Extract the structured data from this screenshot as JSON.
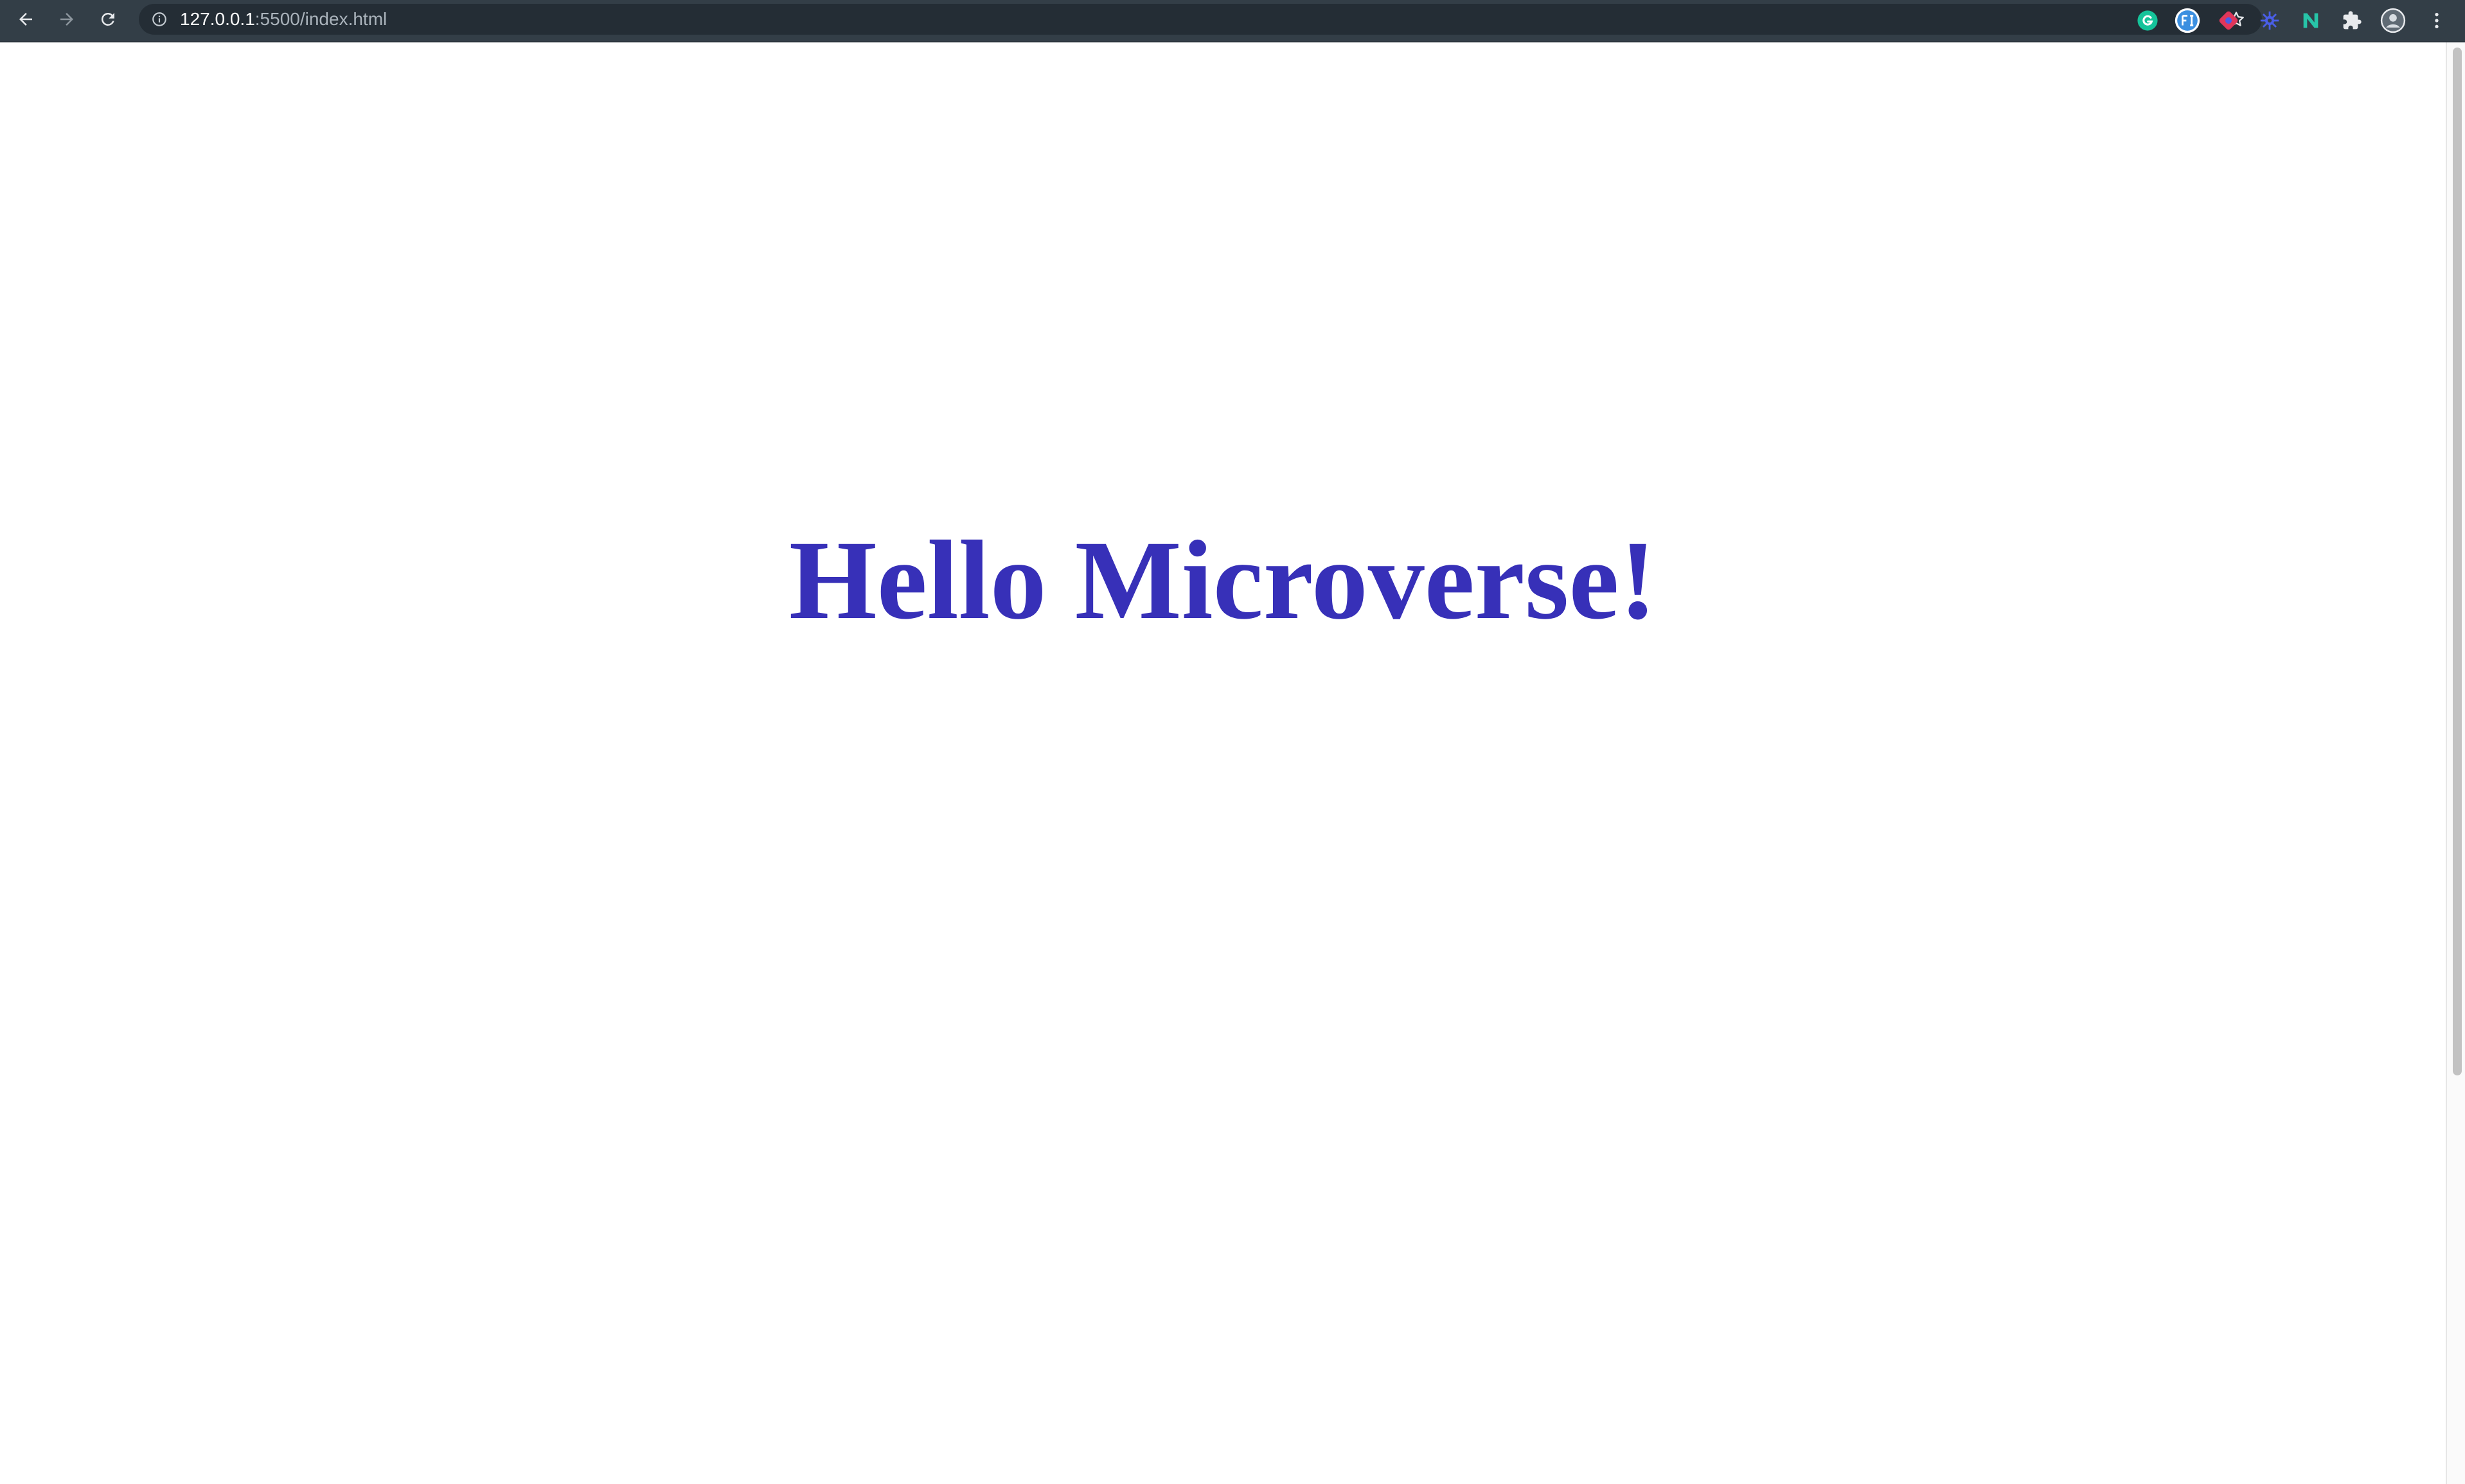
{
  "browser": {
    "url": {
      "host": "127.0.0.1",
      "rest": ":5500/index.html"
    },
    "toolbar_icons": {
      "back": "back-arrow-icon",
      "forward": "forward-arrow-icon",
      "reload": "reload-icon",
      "site_info": "info-icon",
      "bookmark": "star-icon"
    },
    "extensions": [
      {
        "name": "grammarly-icon",
        "label": "G",
        "color": "#15c39a"
      },
      {
        "name": "fi-extension-icon",
        "label": "FI",
        "color": "#3b8fe0"
      },
      {
        "name": "red-extension-icon",
        "label": "",
        "color": "#e0365a"
      },
      {
        "name": "gear-extension-icon",
        "label": "",
        "color": "#4a5ee8"
      },
      {
        "name": "n-extension-icon",
        "label": "N",
        "color": "#27c4a8"
      },
      {
        "name": "puzzle-extensions-icon",
        "label": "",
        "color": "#e8eaed"
      },
      {
        "name": "profile-avatar",
        "label": "",
        "color": "#e8eaed"
      },
      {
        "name": "browser-menu-icon",
        "label": "",
        "color": "#e8eaed"
      }
    ],
    "colors": {
      "toolbar": "#333e47",
      "omnibox": "#242d35"
    }
  },
  "page": {
    "heading": "Hello Microverse!",
    "heading_color": "#3730b8",
    "background": "#ffffff"
  }
}
